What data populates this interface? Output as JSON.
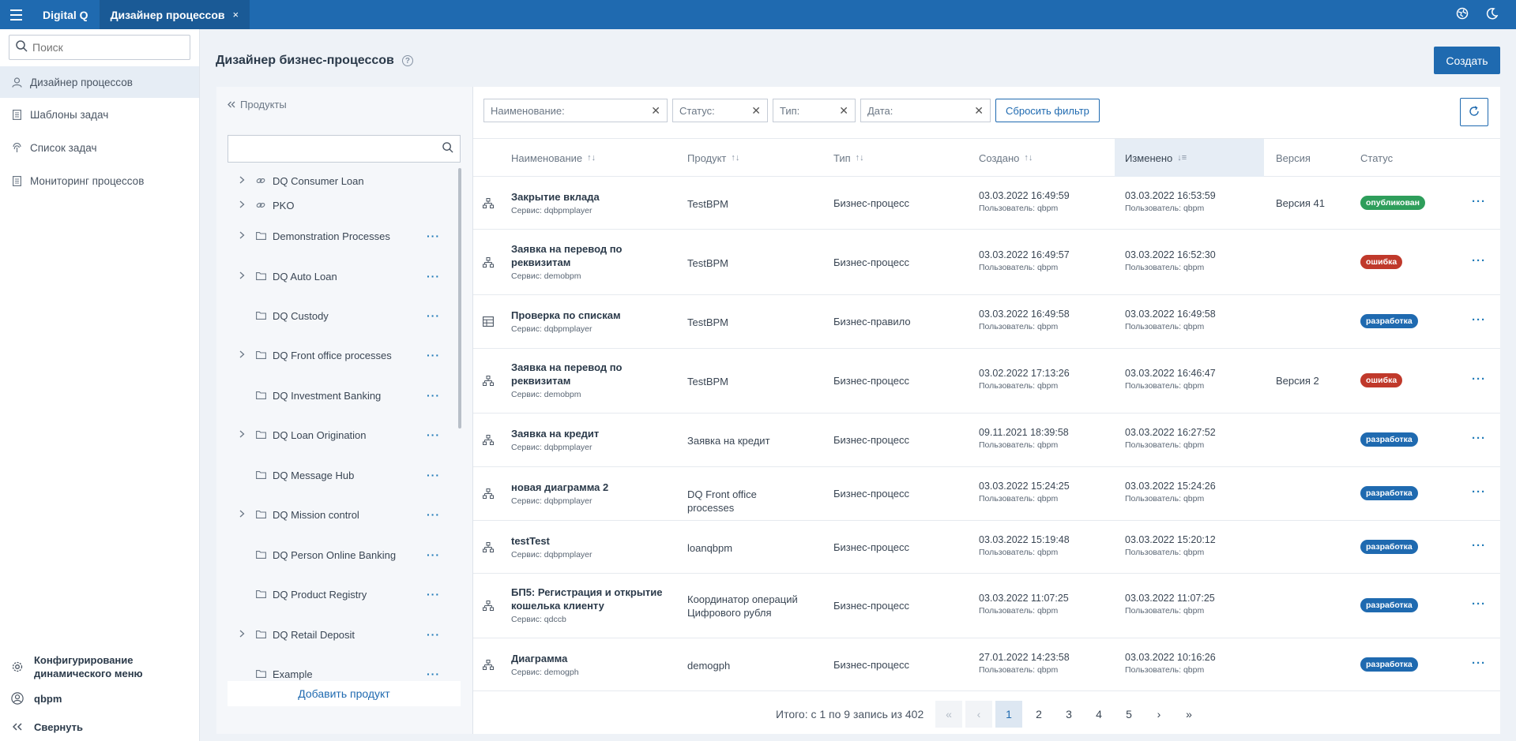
{
  "topbar": {
    "app_name": "Digital Q",
    "active_tab": "Дизайнер процессов",
    "close_glyph": "×"
  },
  "sidebar": {
    "search_placeholder": "Поиск",
    "items": [
      {
        "label": "Дизайнер процессов",
        "icon": "user-icon"
      },
      {
        "label": "Шаблоны задач",
        "icon": "document-icon"
      },
      {
        "label": "Список задач",
        "icon": "fingerprint-icon"
      },
      {
        "label": "Мониторинг процессов",
        "icon": "document-icon"
      }
    ],
    "config_label_1": "Конфигурирование",
    "config_label_2": "динамического меню",
    "user": "qbpm",
    "collapse": "Свернуть"
  },
  "main": {
    "title": "Дизайнер бизнес-процессов",
    "help_glyph": "?",
    "create_button": "Создать"
  },
  "products": {
    "back_label": "Продукты",
    "items": [
      {
        "label": "DQ Consumer Loan",
        "chevron": true,
        "icon": "link-icon",
        "menu": false
      },
      {
        "label": "PKO",
        "chevron": true,
        "icon": "link-icon",
        "menu": false
      },
      {
        "label": "Demonstration Processes",
        "chevron": true,
        "icon": "folder-icon",
        "menu": true
      },
      {
        "label": "DQ Auto Loan",
        "chevron": true,
        "icon": "folder-icon",
        "menu": true
      },
      {
        "label": "DQ Custody",
        "chevron": false,
        "icon": "folder-icon",
        "menu": true
      },
      {
        "label": "DQ Front office processes",
        "chevron": true,
        "icon": "folder-icon",
        "menu": true
      },
      {
        "label": "DQ Investment Banking",
        "chevron": false,
        "icon": "folder-icon",
        "menu": true
      },
      {
        "label": "DQ Loan Origination",
        "chevron": true,
        "icon": "folder-icon",
        "menu": true
      },
      {
        "label": "DQ Message Hub",
        "chevron": false,
        "icon": "folder-icon",
        "menu": true
      },
      {
        "label": "DQ Mission control",
        "chevron": true,
        "icon": "folder-icon",
        "menu": true
      },
      {
        "label": "DQ Person Online Banking",
        "chevron": false,
        "icon": "folder-icon",
        "menu": true
      },
      {
        "label": "DQ Product Registry",
        "chevron": false,
        "icon": "folder-icon",
        "menu": true
      },
      {
        "label": "DQ Retail Deposit",
        "chevron": true,
        "icon": "folder-icon",
        "menu": true
      },
      {
        "label": "Example",
        "chevron": false,
        "icon": "folder-icon",
        "menu": true
      }
    ],
    "add_button": "Добавить продукт",
    "menu_glyph": "···"
  },
  "filters": {
    "name": "Наименование:",
    "status": "Статус:",
    "type": "Тип:",
    "date": "Дата:",
    "reset": "Сбросить фильтр"
  },
  "table": {
    "columns": {
      "name": "Наименование",
      "product": "Продукт",
      "type": "Тип",
      "created": "Создано",
      "modified": "Изменено",
      "version": "Версия",
      "status": "Статус"
    },
    "rows": [
      {
        "name": "Закрытие вклада",
        "service": "Сервис: dqbpmplayer",
        "product": "TestBPM",
        "type": "Бизнес-процесс",
        "created": "03.03.2022 16:49:59",
        "created_by": "Пользователь: qbpm",
        "modified": "03.03.2022 16:53:59",
        "modified_by": "Пользователь: qbpm",
        "version": "Версия 41",
        "status": "опубликован",
        "status_color": "#2e9e5b",
        "icon": "process-icon"
      },
      {
        "name": "Заявка на перевод по реквизитам",
        "service": "Сервис: demobpm",
        "product": "TestBPM",
        "type": "Бизнес-процесс",
        "created": "03.03.2022 16:49:57",
        "created_by": "Пользователь: qbpm",
        "modified": "03.03.2022 16:52:30",
        "modified_by": "Пользователь: qbpm",
        "version": "",
        "status": "ошибка",
        "status_color": "#c0392b",
        "icon": "process-icon"
      },
      {
        "name": "Проверка по спискам",
        "service": "Сервис: dqbpmplayer",
        "product": "TestBPM",
        "type": "Бизнес-правило",
        "created": "03.03.2022 16:49:58",
        "created_by": "Пользователь: qbpm",
        "modified": "03.03.2022 16:49:58",
        "modified_by": "Пользователь: qbpm",
        "version": "",
        "status": "разработка",
        "status_color": "#1f6ab0",
        "icon": "table-icon"
      },
      {
        "name": "Заявка на перевод по реквизитам",
        "service": "Сервис: demobpm",
        "product": "TestBPM",
        "type": "Бизнес-процесс",
        "created": "03.02.2022 17:13:26",
        "created_by": "Пользователь: qbpm",
        "modified": "03.03.2022 16:46:47",
        "modified_by": "Пользователь: qbpm",
        "version": "Версия 2",
        "status": "ошибка",
        "status_color": "#c0392b",
        "icon": "process-icon"
      },
      {
        "name": "Заявка на кредит",
        "service": "Сервис: dqbpmplayer",
        "product": "Заявка на кредит",
        "type": "Бизнес-процесс",
        "created": "09.11.2021 18:39:58",
        "created_by": "Пользователь: qbpm",
        "modified": "03.03.2022 16:27:52",
        "modified_by": "Пользователь: qbpm",
        "version": "",
        "status": "разработка",
        "status_color": "#1f6ab0",
        "icon": "process-icon"
      },
      {
        "name": "новая диаграмма 2",
        "service": "Сервис: dqbpmplayer",
        "product": "DQ Front office processes",
        "type": "Бизнес-процесс",
        "created": "03.03.2022 15:24:25",
        "created_by": "Пользователь: qbpm",
        "modified": "03.03.2022 15:24:26",
        "modified_by": "Пользователь: qbpm",
        "version": "",
        "status": "разработка",
        "status_color": "#1f6ab0",
        "icon": "process-icon"
      },
      {
        "name": "testTest",
        "service": "Сервис: dqbpmplayer",
        "product": "loanqbpm",
        "type": "Бизнес-процесс",
        "created": "03.03.2022 15:19:48",
        "created_by": "Пользователь: qbpm",
        "modified": "03.03.2022 15:20:12",
        "modified_by": "Пользователь: qbpm",
        "version": "",
        "status": "разработка",
        "status_color": "#1f6ab0",
        "icon": "process-icon"
      },
      {
        "name": "БП5: Регистрация и открытие кошелька клиенту",
        "service": "Сервис: qdccb",
        "product": "Координатор операций Цифрового рубля",
        "type": "Бизнес-процесс",
        "created": "03.03.2022 11:07:25",
        "created_by": "Пользователь: qbpm",
        "modified": "03.03.2022 11:07:25",
        "modified_by": "Пользователь: qbpm",
        "version": "",
        "status": "разработка",
        "status_color": "#1f6ab0",
        "icon": "process-icon"
      },
      {
        "name": "Диаграмма",
        "service": "Сервис: demogph",
        "product": "demogph",
        "type": "Бизнес-процесс",
        "created": "27.01.2022 14:23:58",
        "created_by": "Пользователь: qbpm",
        "modified": "03.03.2022 10:16:26",
        "modified_by": "Пользователь: qbpm",
        "version": "",
        "status": "разработка",
        "status_color": "#1f6ab0",
        "icon": "process-icon"
      }
    ],
    "row_menu_glyph": "···"
  },
  "pagination": {
    "total": "Итого: с 1 по 9 запись из 402",
    "first": "«",
    "prev": "‹",
    "pages": [
      "1",
      "2",
      "3",
      "4",
      "5"
    ],
    "current": "1",
    "next": "›",
    "last": "»"
  }
}
